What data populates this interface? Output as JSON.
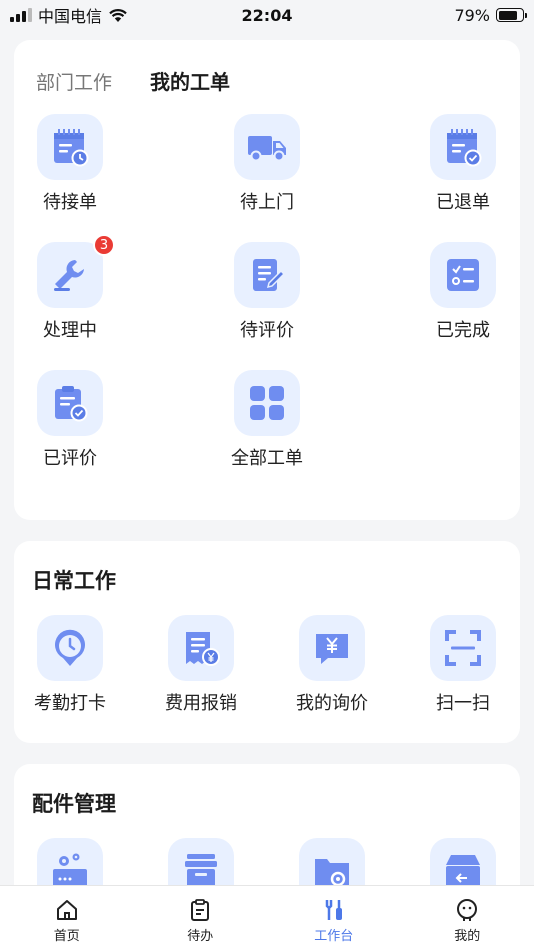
{
  "status_bar": {
    "carrier": "中国电信",
    "time": "22:04",
    "battery": "79%",
    "battery_level": 0.79
  },
  "my_orders": {
    "tabs": [
      {
        "label": "部门工作",
        "active": false
      },
      {
        "label": "我的工单",
        "active": true
      }
    ],
    "items": [
      {
        "label": "待接单",
        "icon": "calendar-clock-icon"
      },
      {
        "label": "待上门",
        "icon": "truck-icon"
      },
      {
        "label": "已退单",
        "icon": "calendar-check-icon"
      },
      {
        "label": "处理中",
        "icon": "wrench-icon",
        "badge": "3"
      },
      {
        "label": "待评价",
        "icon": "edit-document-icon"
      },
      {
        "label": "已完成",
        "icon": "checklist-icon"
      },
      {
        "label": "已评价",
        "icon": "clipboard-check-icon"
      },
      {
        "label": "全部工单",
        "icon": "grid-icon"
      }
    ]
  },
  "daily_work": {
    "title": "日常工作",
    "items": [
      {
        "label": "考勤打卡",
        "icon": "clock-pin-icon"
      },
      {
        "label": "费用报销",
        "icon": "receipt-yen-icon"
      },
      {
        "label": "我的询价",
        "icon": "chat-yen-icon"
      },
      {
        "label": "扫一扫",
        "icon": "scan-icon"
      }
    ]
  },
  "parts_management": {
    "title": "配件管理",
    "items": [
      {
        "icon": "gear-device-icon"
      },
      {
        "icon": "archive-drawer-icon"
      },
      {
        "icon": "folder-settings-icon"
      },
      {
        "icon": "box-return-icon"
      }
    ]
  },
  "tabbar": {
    "items": [
      {
        "label": "首页",
        "icon": "home-icon",
        "active": false
      },
      {
        "label": "待办",
        "icon": "clipboard-icon",
        "active": false
      },
      {
        "label": "工作台",
        "icon": "tools-icon",
        "active": true
      },
      {
        "label": "我的",
        "icon": "profile-icon",
        "active": false
      }
    ]
  },
  "colors": {
    "accent": "#4d78e8",
    "icon_fill": "#6f8df0",
    "icon_bg": "#e8f0ff",
    "badge": "#ea3b35"
  }
}
